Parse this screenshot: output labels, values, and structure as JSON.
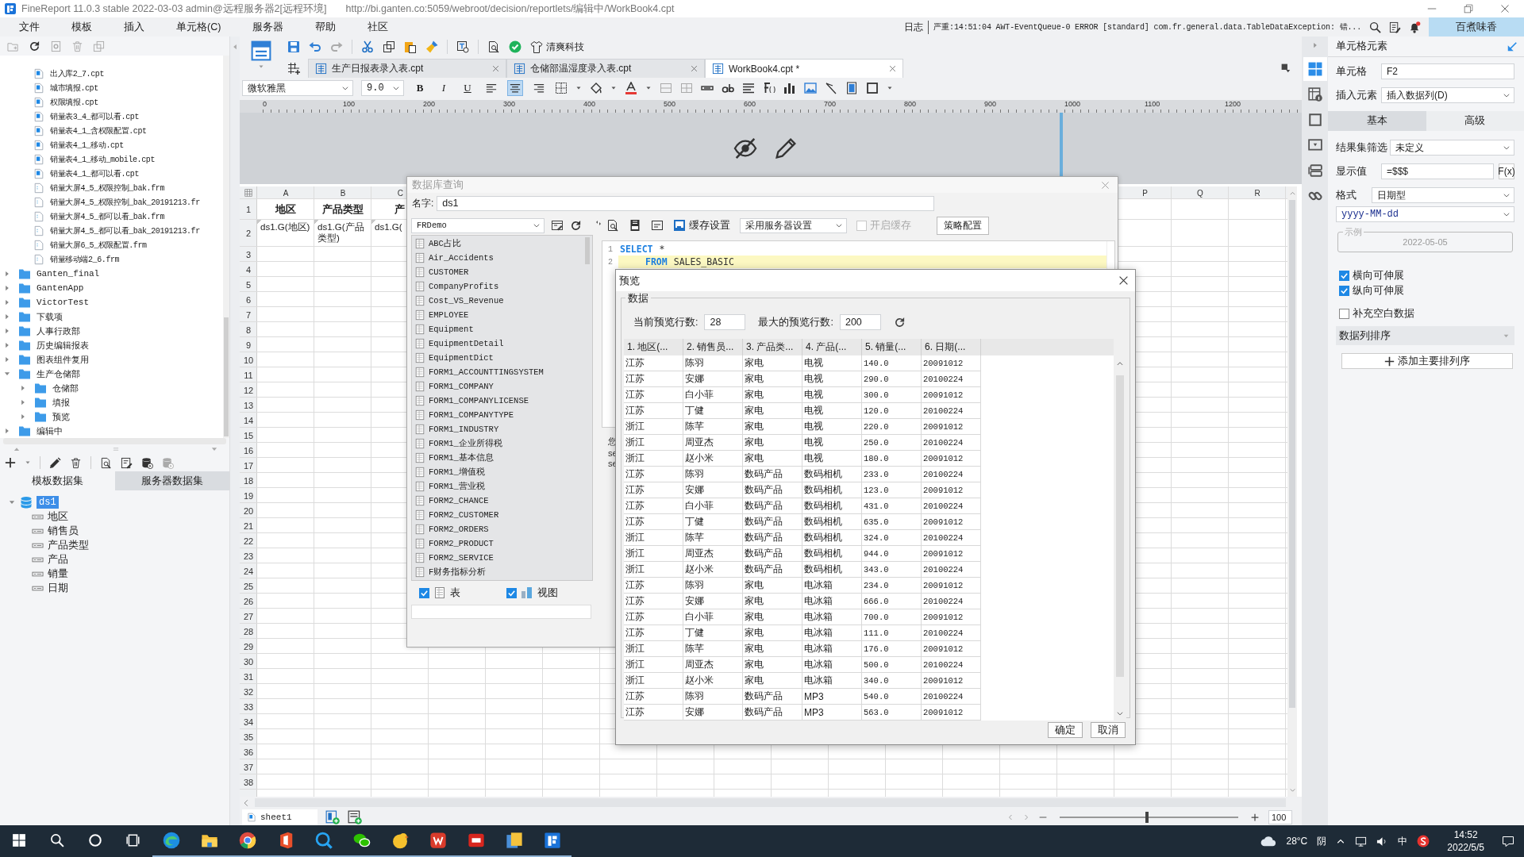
{
  "window": {
    "title": "FineReport 11.0.3 stable 2022-03-03 admin@远程服务器2[远程环境]",
    "url": "http://bi.ganten.co:5059/webroot/decision/reportlets/编辑中/WorkBook4.cpt"
  },
  "menu": [
    "文件",
    "模板",
    "插入",
    "单元格(C)",
    "服务器",
    "帮助",
    "社区"
  ],
  "log": {
    "label": "日志",
    "message": "严重:14:51:04 AWT-EventQueue-0 ERROR [standard] com.fr.general.data.TableDataException: 错..."
  },
  "user": "百煮味香",
  "file_tree": {
    "files": [
      {
        "label": "出入库2_7.cpt",
        "kind": "cpt"
      },
      {
        "label": "城市填报.cpt",
        "kind": "cpt"
      },
      {
        "label": "权限填报.cpt",
        "kind": "cpt"
      },
      {
        "label": "销量表3_4_都可以看.cpt",
        "kind": "cpt"
      },
      {
        "label": "销量表4_1_含权限配置.cpt",
        "kind": "cpt"
      },
      {
        "label": "销量表4_1_移动.cpt",
        "kind": "cpt"
      },
      {
        "label": "销量表4_1_移动_mobile.cpt",
        "kind": "cpt"
      },
      {
        "label": "销量表4_1_都可以看.cpt",
        "kind": "cpt"
      },
      {
        "label": "销量大屏4_5_权限控制_bak.frm",
        "kind": "frm"
      },
      {
        "label": "销量大屏4_5_权限控制_bak_20191213.fr",
        "kind": "frm"
      },
      {
        "label": "销量大屏4_5_都可以看_bak.frm",
        "kind": "frm"
      },
      {
        "label": "销量大屏4_5_都可以看_bak_20191213.fr",
        "kind": "frm"
      },
      {
        "label": "销量大屏6_5_权限配置.frm",
        "kind": "frm"
      },
      {
        "label": "销量移动端2_6.frm",
        "kind": "frm"
      }
    ],
    "folders": [
      {
        "label": "Ganten_final",
        "expanded": false
      },
      {
        "label": "GantenApp",
        "expanded": false
      },
      {
        "label": "VictorTest",
        "expanded": false
      },
      {
        "label": "下载项",
        "expanded": false
      },
      {
        "label": "人事行政部",
        "expanded": false
      },
      {
        "label": "历史编辑报表",
        "expanded": false
      },
      {
        "label": "图表组件复用",
        "expanded": false
      },
      {
        "label": "生产仓储部",
        "expanded": true,
        "children": [
          {
            "label": "仓储部",
            "expanded": false
          },
          {
            "label": "填报",
            "expanded": false
          },
          {
            "label": "预览",
            "expanded": false
          }
        ]
      },
      {
        "label": "编辑中",
        "expanded": false
      }
    ]
  },
  "datasets": {
    "tabs": [
      {
        "label": "模板数据集",
        "selected": true
      },
      {
        "label": "服务器数据集",
        "selected": false
      }
    ],
    "items": [
      {
        "label": "ds1",
        "expanded": true,
        "selected": true,
        "children": [
          {
            "label": "地区"
          },
          {
            "label": "销售员"
          },
          {
            "label": "产品类型"
          },
          {
            "label": "产品"
          },
          {
            "label": "销量"
          },
          {
            "label": "日期"
          }
        ]
      }
    ]
  },
  "toolbar": {
    "brand_label": "清爽科技"
  },
  "doc_tabs": [
    {
      "label": "生产日报表录入表.cpt",
      "selected": false
    },
    {
      "label": "仓储部温湿度录入表.cpt",
      "selected": false
    },
    {
      "label": "WorkBook4.cpt *",
      "selected": true
    }
  ],
  "format_bar": {
    "font": "微软雅黑",
    "size": "9.0",
    "styles": [
      {
        "label": "B",
        "kind": "bold"
      },
      {
        "label": "I",
        "kind": "italic"
      },
      {
        "label": "U",
        "kind": "underline"
      }
    ],
    "align": [
      {
        "selected": false
      },
      {
        "selected": true
      },
      {
        "selected": false
      }
    ]
  },
  "ruler": [
    "0",
    "100",
    "200",
    "300",
    "400",
    "500",
    "600",
    "700",
    "800",
    "900",
    "1000",
    "1100",
    "1200"
  ],
  "sheet": {
    "columns_left": [
      "A",
      "B",
      "C"
    ],
    "columns_right": [
      "P",
      "Q",
      "R"
    ],
    "rows": [
      {
        "number": "1",
        "kind": "header",
        "cells": [
          "地区",
          "产品类型",
          "产"
        ]
      },
      {
        "number": "2",
        "kind": "binding",
        "cells": [
          "ds1.G(地区)",
          "ds1.G(产品类型)",
          "ds1.G("
        ]
      }
    ],
    "empty_rows": [
      "3",
      "4",
      "5",
      "6",
      "7",
      "8",
      "9",
      "10",
      "11",
      "12",
      "13",
      "14",
      "15",
      "16",
      "17",
      "18",
      "19",
      "20",
      "21",
      "22",
      "23",
      "24",
      "25",
      "26",
      "27",
      "28",
      "29",
      "30",
      "31",
      "32",
      "33",
      "34",
      "35",
      "36",
      "37",
      "38"
    ]
  },
  "sheet_tabs": [
    {
      "label": "sheet1",
      "selected": true
    }
  ],
  "zoom": {
    "level": 0.49,
    "value": "100"
  },
  "db_dialog": {
    "title": "数据库查询",
    "name_label": "名字:",
    "name": "ds1",
    "connection": "FRDemo",
    "tables": [
      "ABC占比",
      "Air_Accidents",
      "CUSTOMER",
      "CompanyProfits",
      "Cost_VS_Revenue",
      "EMPLOYEE",
      "Equipment",
      "EquipmentDetail",
      "EquipmentDict",
      "FORM1_ACCOUNTTINGSYSTEM",
      "FORM1_COMPANY",
      "FORM1_COMPANYLICENSE",
      "FORM1_COMPANYTYPE",
      "FORM1_INDUSTRY",
      "FORM1_企业所得税",
      "FORM1_基本信息",
      "FORM1_增值税",
      "FORM1_营业税",
      "FORM2_CHANCE",
      "FORM2_CUSTOMER",
      "FORM2_ORDERS",
      "FORM2_PRODUCT",
      "FORM2_SERVICE",
      "F财务指标分析"
    ],
    "filters": [
      {
        "label": "表",
        "kind": "table",
        "checked": true
      },
      {
        "label": "视图",
        "kind": "view",
        "checked": true
      }
    ],
    "cache_label": "缓存设置",
    "cache_mode": "采用服务器设置",
    "cache_toggle": {
      "label": "开启缓存",
      "checked": false,
      "disabled": true
    },
    "strategy_button": "策略配置",
    "sql": [
      {
        "number": "1",
        "highlighted": false,
        "indent": false,
        "tokens": [
          {
            "kind": "keyword",
            "text": "SELECT"
          },
          {
            "kind": "plain",
            "text": "*"
          }
        ]
      },
      {
        "number": "2",
        "highlighted": true,
        "indent": true,
        "tokens": [
          {
            "kind": "keyword",
            "text": "FROM"
          },
          {
            "kind": "plain",
            "text": "SALES_BASIC"
          }
        ]
      }
    ],
    "hint_fragments": [
      "您",
      "se",
      "se"
    ]
  },
  "preview": {
    "title": "预览",
    "group": "数据",
    "current_label": "当前预览行数:",
    "current": "28",
    "max_label": "最大的预览行数:",
    "max": "200",
    "columns": [
      "1. 地区(...",
      "2. 销售员...",
      "3. 产品类...",
      "4. 产品(...",
      "5. 销量(...",
      "6. 日期(..."
    ],
    "rows": [
      [
        "江苏",
        "陈羽",
        "家电",
        "电视",
        "140.0",
        "20091012"
      ],
      [
        "江苏",
        "安娜",
        "家电",
        "电视",
        "290.0",
        "20100224"
      ],
      [
        "江苏",
        "白小菲",
        "家电",
        "电视",
        "300.0",
        "20091012"
      ],
      [
        "江苏",
        "丁健",
        "家电",
        "电视",
        "120.0",
        "20100224"
      ],
      [
        "浙江",
        "陈芊",
        "家电",
        "电视",
        "220.0",
        "20091012"
      ],
      [
        "浙江",
        "周亚杰",
        "家电",
        "电视",
        "250.0",
        "20100224"
      ],
      [
        "浙江",
        "赵小米",
        "家电",
        "电视",
        "180.0",
        "20091012"
      ],
      [
        "江苏",
        "陈羽",
        "数码产品",
        "数码相机",
        "233.0",
        "20100224"
      ],
      [
        "江苏",
        "安娜",
        "数码产品",
        "数码相机",
        "123.0",
        "20091012"
      ],
      [
        "江苏",
        "白小菲",
        "数码产品",
        "数码相机",
        "431.0",
        "20100224"
      ],
      [
        "江苏",
        "丁健",
        "数码产品",
        "数码相机",
        "635.0",
        "20091012"
      ],
      [
        "浙江",
        "陈芊",
        "数码产品",
        "数码相机",
        "324.0",
        "20100224"
      ],
      [
        "浙江",
        "周亚杰",
        "数码产品",
        "数码相机",
        "944.0",
        "20091012"
      ],
      [
        "浙江",
        "赵小米",
        "数码产品",
        "数码相机",
        "343.0",
        "20100224"
      ],
      [
        "江苏",
        "陈羽",
        "家电",
        "电冰箱",
        "234.0",
        "20091012"
      ],
      [
        "江苏",
        "安娜",
        "家电",
        "电冰箱",
        "666.0",
        "20100224"
      ],
      [
        "江苏",
        "白小菲",
        "家电",
        "电冰箱",
        "700.0",
        "20091012"
      ],
      [
        "江苏",
        "丁健",
        "家电",
        "电冰箱",
        "111.0",
        "20100224"
      ],
      [
        "浙江",
        "陈芊",
        "家电",
        "电冰箱",
        "176.0",
        "20091012"
      ],
      [
        "浙江",
        "周亚杰",
        "家电",
        "电冰箱",
        "500.0",
        "20100224"
      ],
      [
        "浙江",
        "赵小米",
        "家电",
        "电冰箱",
        "340.0",
        "20091012"
      ],
      [
        "江苏",
        "陈羽",
        "数码产品",
        "MP3",
        "540.0",
        "20100224"
      ],
      [
        "江苏",
        "安娜",
        "数码产品",
        "MP3",
        "563.0",
        "20091012"
      ]
    ],
    "buttons": [
      "确定",
      "取消"
    ]
  },
  "cell_panel": {
    "title": "单元格元素",
    "side_tabs": [
      {
        "kind": "cell",
        "selected": true
      },
      {
        "kind": "attributes",
        "selected": false
      },
      {
        "kind": "frame",
        "selected": false
      },
      {
        "kind": "widget",
        "selected": false
      },
      {
        "kind": "condition",
        "selected": false
      },
      {
        "kind": "link",
        "selected": false
      }
    ],
    "cell_label": "单元格",
    "cell": "F2",
    "insert_label": "插入元素",
    "insert": "插入数据列(D)",
    "tabs": [
      {
        "label": "基本",
        "selected": true
      },
      {
        "label": "高级",
        "selected": false
      }
    ],
    "filter_label": "结果集筛选",
    "filter": "未定义",
    "display_label": "显示值",
    "display": "=$$$",
    "formula_button": "F(x)",
    "format_label": "格式",
    "format": "日期型",
    "pattern": "yyyy-MM-dd",
    "example_label": "示例",
    "example": "2022-05-05",
    "options": [
      {
        "label": "横向可伸展",
        "checked": true
      },
      {
        "label": "纵向可伸展",
        "checked": true
      },
      {
        "label": "补充空白数据",
        "checked": false
      }
    ],
    "sort_label": "数据列排序",
    "add_sort": "添加主要排列序"
  },
  "taskbar": {
    "weather": "28°C",
    "condition": "阴",
    "ime": "中",
    "time": "14:52",
    "date": "2022/5/5"
  }
}
